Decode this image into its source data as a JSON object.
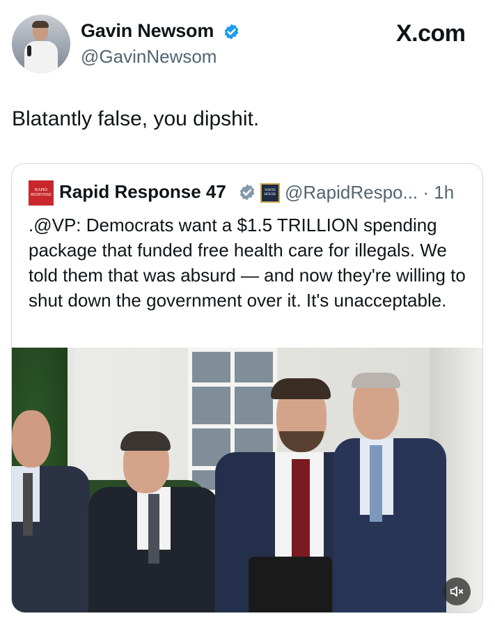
{
  "author": {
    "name": "Gavin Newsom",
    "handle": "@GavinNewsom",
    "verified": true
  },
  "site_label": "X.com",
  "tweet_text": "Blatantly false, you dipshit.",
  "quoted": {
    "logo_text": "RAPID RESPONSE",
    "name": "Rapid Response 47",
    "affiliate_badge_text": "WHITE HOUSE",
    "handle_time": "@RapidRespo... · 1h",
    "text": ".@VP: Democrats want a $1.5 TRILLION spending package that funded free health care for illegals. We told them that was absurd — and now they're willing to shut down the government over it. It's unacceptable."
  },
  "colors": {
    "verified_blue": "#1d9bf0",
    "handle_gray": "#536471",
    "border": "#cfd9de"
  },
  "icons": [
    "verified-badge-icon",
    "white-house-affiliate-icon",
    "mute-icon"
  ]
}
